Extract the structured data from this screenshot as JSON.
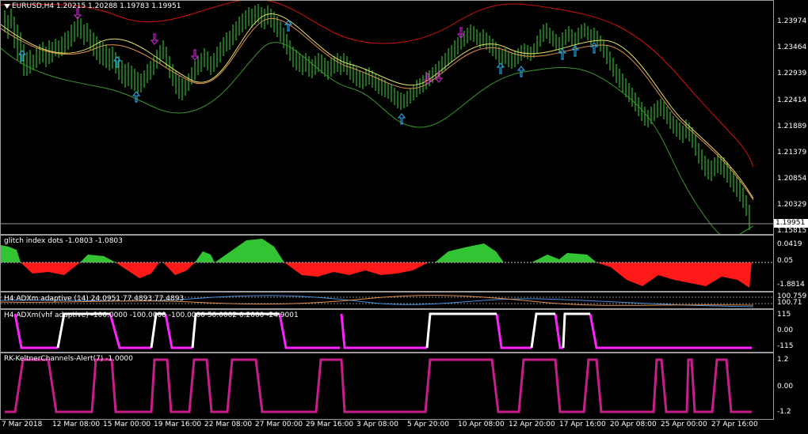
{
  "main": {
    "title": "EURUSD,H4  1.20215 1.20288 1.19783 1.19951",
    "current_price": "1.19951",
    "prev_label": "1.15815",
    "ticks": [
      "1.23974",
      "1.23464",
      "1.22939",
      "1.22414",
      "1.21889",
      "1.21379",
      "1.20854",
      "1.20329"
    ]
  },
  "glitch": {
    "title": "glitch index dots -1.0803 -1.0803",
    "ticks": [
      "0.0419",
      "0.05",
      "-1.8814"
    ]
  },
  "adxm": {
    "title": "H4 ADXm adaptive (14) 24.0951 77.4893 77.4893",
    "ticks": [
      "100.759",
      "100.71"
    ]
  },
  "adxvhf": {
    "title": "H4 ADXm(vhf adaptive) -100.0000 -100.0000 -100.0000 50.0002 0.2000 -24.9001",
    "ticks": [
      "115",
      "0.00",
      "-115"
    ]
  },
  "keltner": {
    "title": "RK-KeltnerChannels-Alert(7) -1.0000",
    "ticks": [
      "1.2",
      "0.00",
      "-1.2"
    ]
  },
  "time_axis": [
    "7 Mar 2018",
    "12 Mar 08:00",
    "15 Mar 00:00",
    "19 Mar 16:00",
    "22 Mar 08:00",
    "27 Mar 00:00",
    "29 Mar 16:00",
    "3 Apr 08:00",
    "5 Apr 20:00",
    "10 Apr 08:00",
    "12 Apr 20:00",
    "17 Apr 16:00",
    "20 Apr 08:00",
    "25 Apr 00:00",
    "27 Apr 16:00"
  ],
  "colors": {
    "up_bar": "#33dd33",
    "upper_band": "#d21010",
    "lower_band": "#3a9a2a",
    "ma_yellow": "#e8e060",
    "ma_orange": "#e09050",
    "arrow_up": "#2a9ad8",
    "arrow_down": "#c020c0",
    "glitch_pos": "#33c433",
    "glitch_neg": "#ff1a1a",
    "adx_white": "#ffffff",
    "adx_magenta": "#ff22ff",
    "keltner": "#c81e8c"
  }
}
